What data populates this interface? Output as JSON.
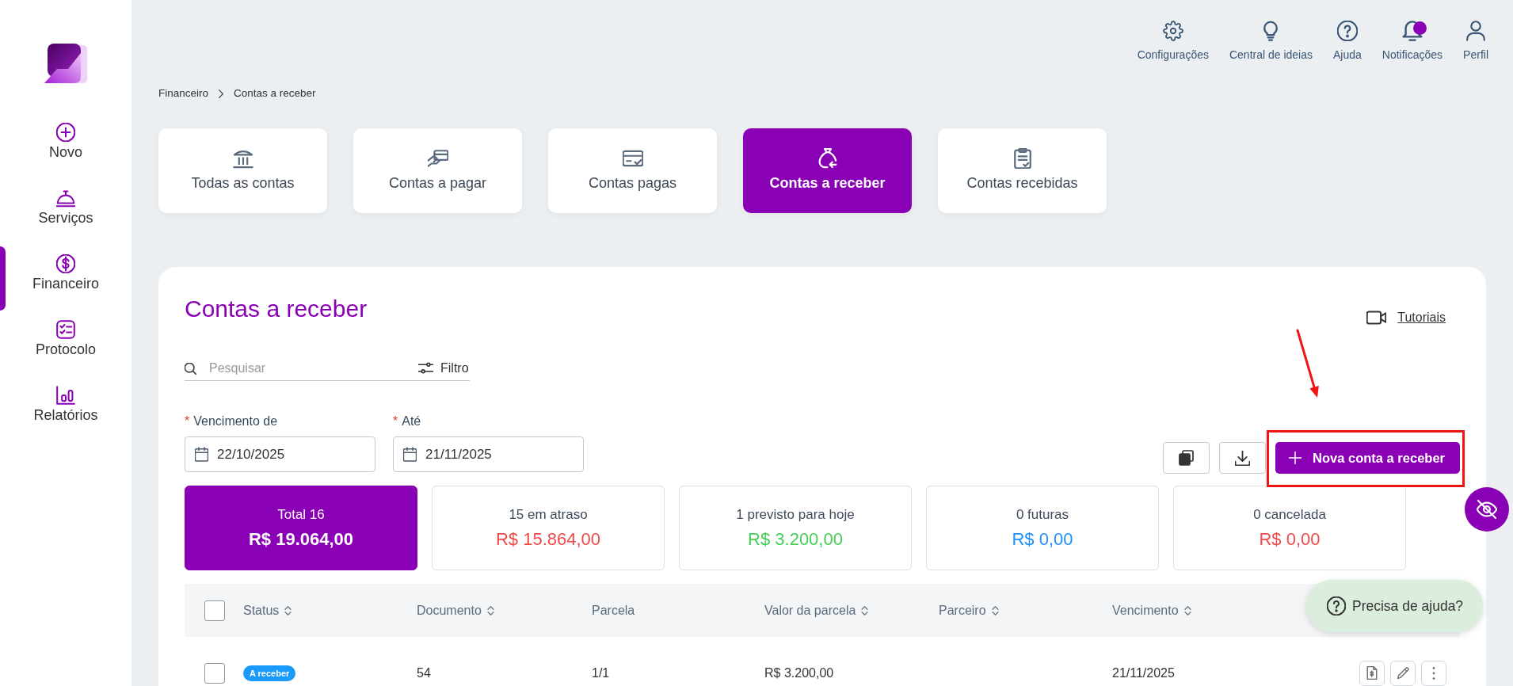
{
  "sidebar": {
    "items": [
      {
        "label": "Novo",
        "selected": false
      },
      {
        "label": "Serviços",
        "selected": false
      },
      {
        "label": "Financeiro",
        "selected": true
      },
      {
        "label": "Protocolo",
        "selected": false
      },
      {
        "label": "Relatórios",
        "selected": false
      }
    ]
  },
  "header": {
    "actions": [
      {
        "label": "Configurações",
        "unread": false
      },
      {
        "label": "Central de ideias",
        "unread": false
      },
      {
        "label": "Ajuda",
        "unread": false
      },
      {
        "label": "Notificações",
        "unread": true
      },
      {
        "label": "Perfil",
        "unread": false
      }
    ]
  },
  "breadcrumb": [
    "Financeiro",
    "Contas a receber"
  ],
  "tabs": [
    {
      "label": "Todas as contas",
      "selected": false
    },
    {
      "label": "Contas a pagar",
      "selected": false
    },
    {
      "label": "Contas pagas",
      "selected": false
    },
    {
      "label": "Contas a receber",
      "selected": true
    },
    {
      "label": "Contas recebidas",
      "selected": false
    }
  ],
  "panel": {
    "title": "Contas a receber",
    "tutorials_link": "Tutoriais",
    "search": {
      "placeholder": "Pesquisar"
    },
    "filter_button": "Filtro",
    "date_fields": [
      {
        "label": "Vencimento de",
        "required_mark": "*",
        "value": "22/10/2025"
      },
      {
        "label": "Até",
        "required_mark": "*",
        "value": "21/11/2025"
      }
    ],
    "primary_button": "Nova conta a receber",
    "summary": [
      {
        "label": "Total 16",
        "amount": "R$ 19.064,00",
        "selected": true,
        "color": "#8a00b4"
      },
      {
        "label": "15 em atraso",
        "amount": "R$ 15.864,00",
        "selected": false,
        "color": "#f04a4a"
      },
      {
        "label": "1 previsto para hoje",
        "amount": "R$ 3.200,00",
        "selected": false,
        "color": "#45cf57"
      },
      {
        "label": "0 futuras",
        "amount": "R$ 0,00",
        "selected": false,
        "color": "#1e8fff"
      },
      {
        "label": "0 cancelada",
        "amount": "R$ 0,00",
        "selected": false,
        "color": "#f04a4a"
      }
    ],
    "table": {
      "header_checkbox": {
        "checked": false
      },
      "columns": [
        {
          "label": "Status",
          "sortable": true
        },
        {
          "label": "Documento",
          "sortable": true
        },
        {
          "label": "Parcela",
          "sortable": false
        },
        {
          "label": "Valor da parcela",
          "sortable": true
        },
        {
          "label": "Parceiro",
          "sortable": true
        },
        {
          "label": "Vencimento",
          "sortable": true
        }
      ],
      "rows": [
        {
          "checked": false,
          "status": {
            "label": "A receber",
            "color": "#1a9bfc"
          },
          "document": "54",
          "installment": "1/1",
          "amount": "R$ 3.200,00",
          "due_date": "21/11/2025"
        }
      ]
    }
  },
  "help_button": {
    "label": "Precisa de ajuda?"
  },
  "annotations": {
    "arrow": true,
    "frame": true
  }
}
